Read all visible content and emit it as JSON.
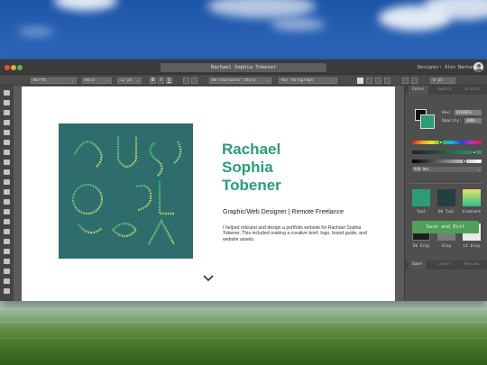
{
  "window": {
    "title": "Rachael Sophia Tobener",
    "designer_label": "Designer: Alex Bachar"
  },
  "control_bar": {
    "font_family": "North",
    "font_weight": "Bold",
    "font_size": "12 pt",
    "bold_label": "B",
    "italic_label": "I",
    "underline_label": "U",
    "character_style": "No Character Style",
    "paragraph_style": "RST Paragraph",
    "offset_value": "0 pt"
  },
  "artboard": {
    "name_line1": "Rachael",
    "name_line2": "Sophia",
    "name_line3": "Tobener",
    "role": "Graphic/Web Designer | Remote Freelance",
    "description": "I helped rebrand and design a portfolio website for Rachael Sophia Tobener. This included making a creative brief, logo, brand guide, and website assets."
  },
  "panel": {
    "tabs": [
      "Color",
      "Swatch",
      "Gradie"
    ],
    "hex_label": "Hex:",
    "hex_value": "#23A87E",
    "opacity_label": "Opacity:",
    "opacity_value": "100%",
    "mode_value": "RGB Hex",
    "swatches": [
      {
        "label": "Teal",
        "color": "#2a9d78"
      },
      {
        "label": "Dk Teal",
        "color": "#21403f"
      },
      {
        "label": "Gradient",
        "color": "#9fcf6a"
      },
      {
        "label": "Dk Gray",
        "color": "#1f1f1f"
      },
      {
        "label": "Gray",
        "color": "#7a7a7a"
      },
      {
        "label": "Lt Gray",
        "color": "#e9e9e9"
      }
    ],
    "bottom_tabs": [
      "Save",
      "Layers",
      "Review"
    ],
    "save_button": "Save and Exit"
  },
  "colors": {
    "accent": "#2a9d78",
    "art_bg": "#2e6d6c",
    "save_button": "#4fa15a"
  },
  "icons": [
    "traffic-lights",
    "avatar-icon",
    "chevron-down-icon",
    "tool-icons"
  ]
}
